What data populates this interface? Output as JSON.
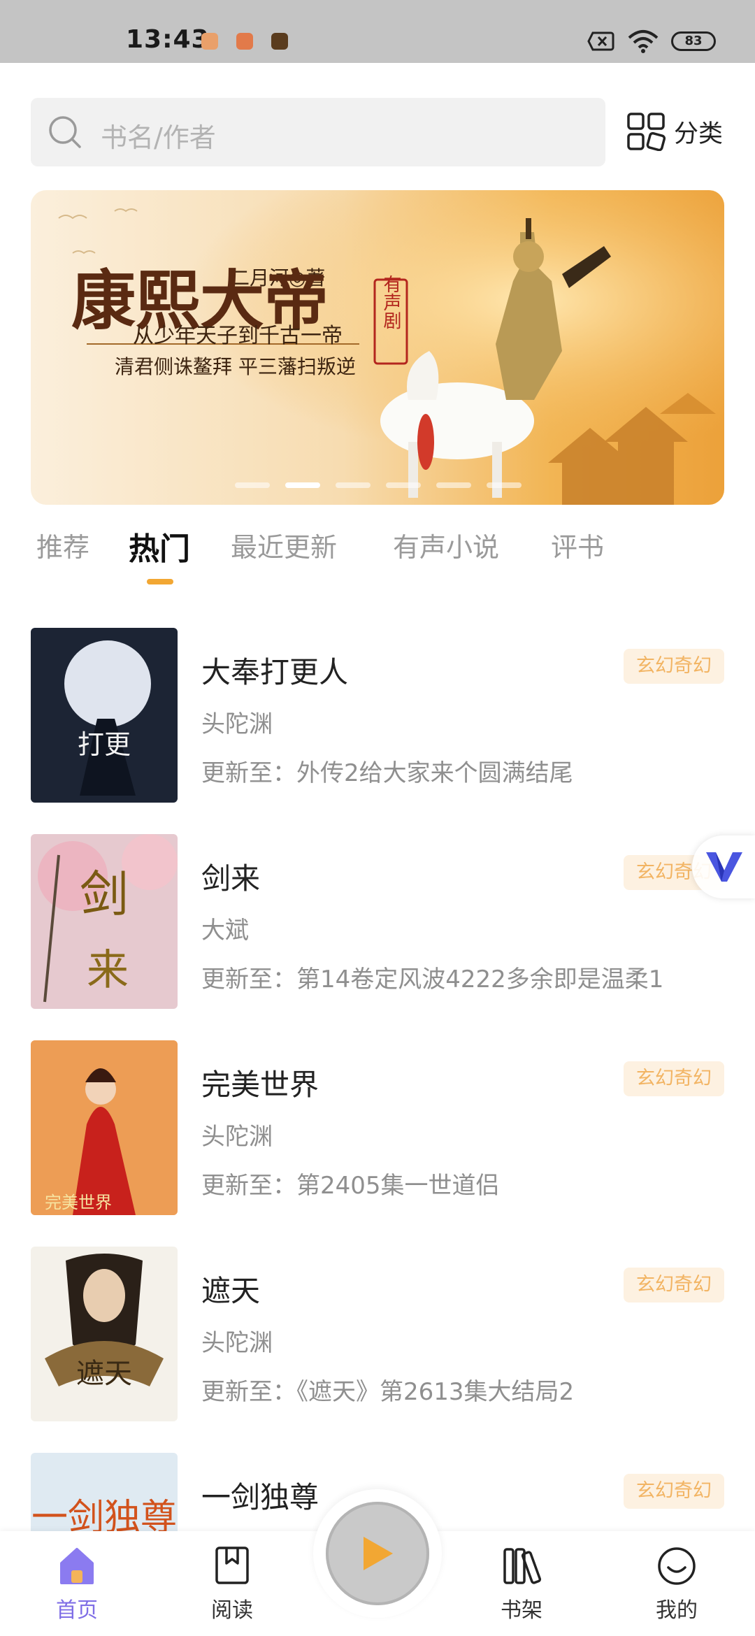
{
  "status_bar": {
    "time": "13:43",
    "battery": "83"
  },
  "search": {
    "placeholder": "书名/作者"
  },
  "category": {
    "label": "分类"
  },
  "banner": {
    "author": "二月河◎著",
    "title": "康熙大帝",
    "badge": "有声剧",
    "subtitle1": "从少年天子到千古一帝",
    "subtitle2": "清君侧诛鳌拜 平三藩扫叛逆",
    "dot_count": 6,
    "active_dot": 1
  },
  "tabs": [
    {
      "label": "推荐"
    },
    {
      "label": "热门"
    },
    {
      "label": "最近更新"
    },
    {
      "label": "有声小说"
    },
    {
      "label": "评书"
    }
  ],
  "active_tab": "热门",
  "books": [
    {
      "title": "大奉打更人",
      "author": "头陀渊",
      "update": "更新至：外传2给大家来个圆满结尾",
      "genre": "玄幻奇幻"
    },
    {
      "title": "剑来",
      "author": "大斌",
      "update": "更新至：第14卷定风波4222多余即是温柔1",
      "genre": "玄幻奇幻"
    },
    {
      "title": "完美世界",
      "author": "头陀渊",
      "update": "更新至：第2405集一世道侣",
      "genre": "玄幻奇幻"
    },
    {
      "title": "遮天",
      "author": "头陀渊",
      "update": "更新至：《遮天》第2613集大结局2",
      "genre": "玄幻奇幻"
    },
    {
      "title": "一剑独尊",
      "author": "",
      "update": "",
      "genre": "玄幻奇幻"
    }
  ],
  "bottom_nav": [
    {
      "label": "首页",
      "icon": "home-icon",
      "active": true
    },
    {
      "label": "阅读",
      "icon": "book-icon",
      "active": false
    },
    {
      "label": "书架",
      "icon": "bookshelf-icon",
      "active": false
    },
    {
      "label": "我的",
      "icon": "profile-icon",
      "active": false
    }
  ],
  "colors": {
    "accent": "#f2a733",
    "tag_bg": "#fdf1e1",
    "tag_text": "#f2b463",
    "nav_active": "#7f6ee6"
  }
}
